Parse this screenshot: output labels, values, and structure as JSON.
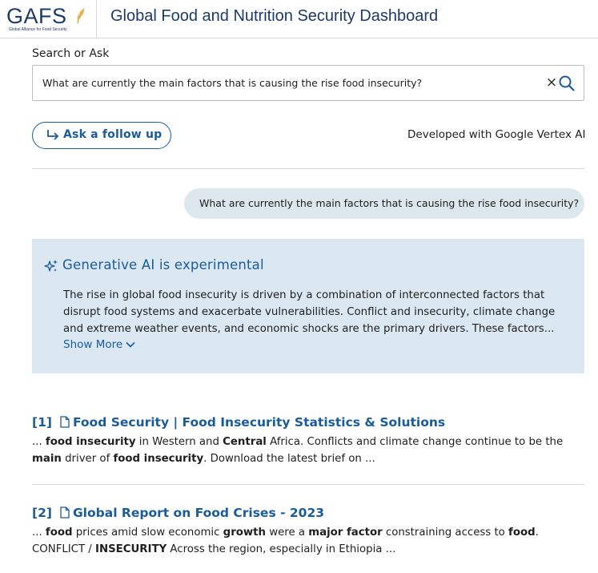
{
  "header": {
    "logo_text": "GAFS",
    "logo_subtitle": "Global Alliance for Food Security",
    "title": "Global Food and Nutrition Security Dashboard"
  },
  "search": {
    "label": "Search or Ask",
    "value": "What are currently the main factors that is causing the rise food insecurity?",
    "clear_icon": "close-icon",
    "search_icon": "search-icon"
  },
  "followup": {
    "label": "Ask a follow up",
    "icon": "arrow-return-icon"
  },
  "developed_with": "Developed with Google Vertex AI",
  "chat": {
    "user_message": "What are currently the main factors that is causing the rise food insecurity?"
  },
  "ai_panel": {
    "title": "Generative AI is experimental",
    "icon": "sparkle-icon",
    "summary_lines": [
      "The rise in global food insecurity is driven by a combination of interconnected factors that",
      "disrupt food systems and exacerbate vulnerabilities. Conflict and insecurity, climate change",
      "and extreme weather events, and economic shocks are the primary drivers. These factors..."
    ],
    "show_more": "Show More"
  },
  "results": [
    {
      "num": "[1]",
      "title": "Food Security | Food Insecurity Statistics & Solutions",
      "snippet_lines": [
        [
          {
            "t": "... ",
            "b": false
          },
          {
            "t": "food insecurity",
            "b": true
          },
          {
            "t": " in Western and ",
            "b": false
          },
          {
            "t": "Central",
            "b": true
          },
          {
            "t": " Africa. Conflicts and climate change continue to be the",
            "b": false
          }
        ],
        [
          {
            "t": "main",
            "b": true
          },
          {
            "t": " driver of ",
            "b": false
          },
          {
            "t": "food insecurity",
            "b": true
          },
          {
            "t": ". Download the latest brief on ...",
            "b": false
          }
        ]
      ]
    },
    {
      "num": "[2]",
      "title": "Global Report on Food Crises - 2023",
      "snippet_lines": [
        [
          {
            "t": "... ",
            "b": false
          },
          {
            "t": "food",
            "b": true
          },
          {
            "t": " prices amid slow economic ",
            "b": false
          },
          {
            "t": "growth",
            "b": true
          },
          {
            "t": " were a ",
            "b": false
          },
          {
            "t": "major factor",
            "b": true
          },
          {
            "t": " constraining access to ",
            "b": false
          },
          {
            "t": "food",
            "b": true
          },
          {
            "t": ".",
            "b": false
          }
        ],
        [
          {
            "t": "CONFLICT / ",
            "b": false
          },
          {
            "t": "INSECURITY",
            "b": true
          },
          {
            "t": " Across the region, especially in Ethiopia ...",
            "b": false
          }
        ]
      ]
    }
  ],
  "colors": {
    "brand": "#1d3a6b",
    "link": "#1a5b9c",
    "ai_panel_bg": "#dbe8f1",
    "bubble_bg": "#dde7ee"
  }
}
